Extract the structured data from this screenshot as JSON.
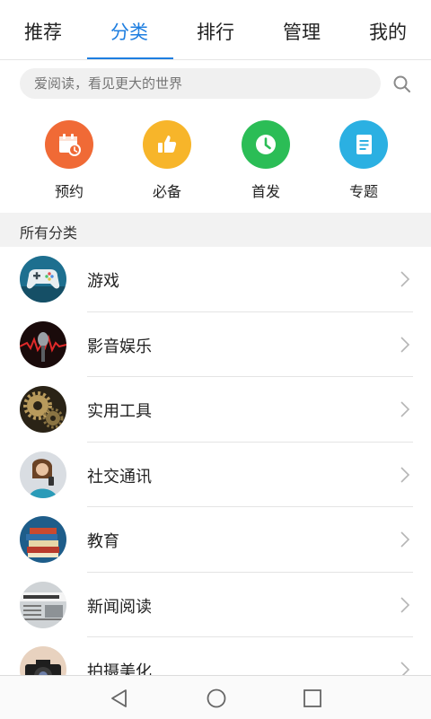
{
  "tabs": [
    {
      "label": "推荐",
      "active": false
    },
    {
      "label": "分类",
      "active": true
    },
    {
      "label": "排行",
      "active": false
    },
    {
      "label": "管理",
      "active": false
    },
    {
      "label": "我的",
      "active": false
    }
  ],
  "search": {
    "placeholder": "爱阅读，看见更大的世界"
  },
  "quick": [
    {
      "label": "预约",
      "icon": "calendar-clock-icon",
      "color": "#f06a36"
    },
    {
      "label": "必备",
      "icon": "thumbs-up-icon",
      "color": "#f7b52a"
    },
    {
      "label": "首发",
      "icon": "clock-icon",
      "color": "#2bbd56"
    },
    {
      "label": "专题",
      "icon": "document-icon",
      "color": "#2bb0e2"
    }
  ],
  "section": {
    "title": "所有分类"
  },
  "categories": [
    {
      "title": "游戏",
      "icon": "gamepad-icon"
    },
    {
      "title": "影音娱乐",
      "icon": "microphone-icon"
    },
    {
      "title": "实用工具",
      "icon": "gears-icon"
    },
    {
      "title": "社交通讯",
      "icon": "person-icon"
    },
    {
      "title": "教育",
      "icon": "books-icon"
    },
    {
      "title": "新闻阅读",
      "icon": "newspaper-icon"
    },
    {
      "title": "拍摄美化",
      "icon": "camera-icon"
    }
  ],
  "accent": "#1e7ee0"
}
